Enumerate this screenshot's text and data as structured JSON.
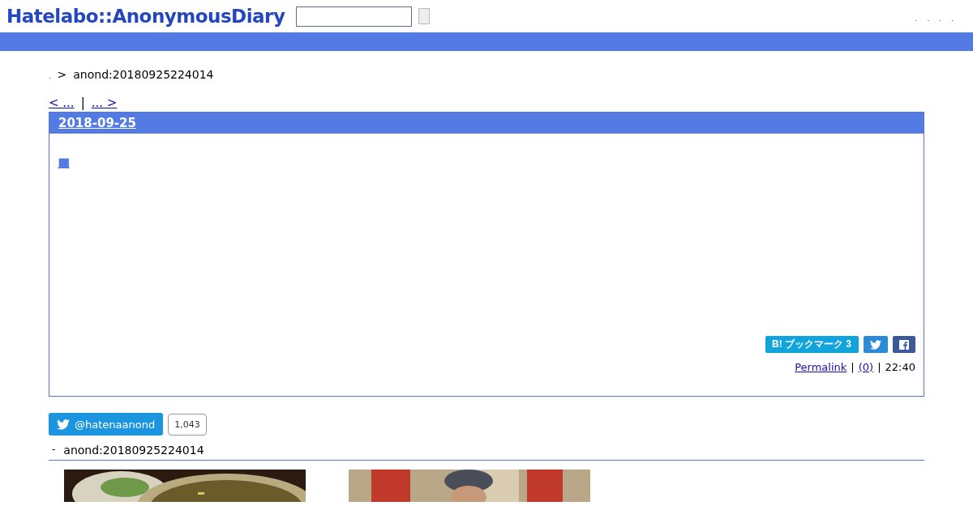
{
  "header": {
    "logo": "Hatelabo::AnonymousDiary",
    "links": [
      ".",
      ".",
      ".",
      "."
    ]
  },
  "breadcrumb": {
    "home": ".",
    "separator": ">",
    "current": "anond:20180925224014"
  },
  "pager": {
    "prev": "< ... ",
    "separator": "|",
    "next": "... > "
  },
  "entry": {
    "date": "2018-09-25",
    "title_mark": "■",
    "bookmark": {
      "label": "B! ブックマーク 3"
    },
    "permalink": "Permalink",
    "separator_1": "|",
    "comments": "(0)",
    "separator_2": "|",
    "time": "22:40"
  },
  "twitter": {
    "handle": "@hatenaanond",
    "count": "1,043"
  },
  "related": {
    "bullet": "-",
    "title": "anond:20180925224014"
  }
}
